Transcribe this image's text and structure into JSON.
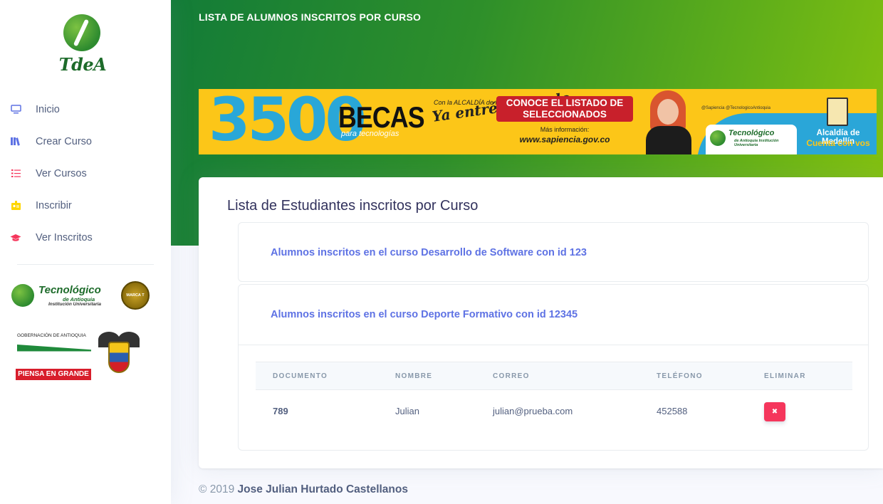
{
  "sidebar": {
    "brand": "TdeA",
    "items": [
      {
        "label": "Inicio",
        "icon": "tv-icon",
        "color": "#5e72e4"
      },
      {
        "label": "Crear Curso",
        "icon": "books-icon",
        "color": "#5e72e4"
      },
      {
        "label": "Ver Cursos",
        "icon": "list-icon",
        "color": "#f5365c"
      },
      {
        "label": "Inscribir",
        "icon": "badge-icon",
        "color": "#ffd600"
      },
      {
        "label": "Ver Inscritos",
        "icon": "graduation-cap-icon",
        "color": "#f5365c"
      }
    ],
    "tda_logo": {
      "title": "Tecnológico",
      "sub1": "de Antioquia",
      "sub2": "Institución Universitaria",
      "seal": "MARCA T"
    },
    "gob_logo": {
      "title": "GOBERNACIÓN DE ANTIOQUIA",
      "slogan": "PIENSA EN GRANDE"
    }
  },
  "header": {
    "title": "LISTA DE ALUMNOS INSCRITOS POR CURSO"
  },
  "banner": {
    "number": "3500",
    "becas": "BECAS",
    "para": "para tecnologías",
    "ya_small": "Con la ALCALDÍA de MEDELLÍN",
    "ya_big": "Ya entré ganando",
    "cta": "CONOCE EL LISTADO DE SELECCIONADOS",
    "more_info": "Más información:",
    "url": "www.sapiencia.gov.co",
    "social": "@Sapiencia  @TecnologicoAntioquia",
    "tda_title": "Tecnológico",
    "tda_sub": "de Antioquia Institución Universitaria",
    "alcaldia": "Alcaldía de Medellín",
    "cuenta": "Cuenta con vos"
  },
  "card": {
    "title": "Lista de Estudiantes inscritos por Curso",
    "courses": [
      {
        "heading": "Alumnos inscritos en el curso Desarrollo de Software con id 123"
      },
      {
        "heading": "Alumnos inscritos en el curso Deporte Formativo con id 12345"
      }
    ],
    "table": {
      "columns": [
        "DOCUMENTO",
        "NOMBRE",
        "CORREO",
        "TELÉFONO",
        "ELIMINAR"
      ],
      "rows": [
        {
          "documento": "789",
          "nombre": "Julian",
          "correo": "julian@prueba.com",
          "telefono": "452588",
          "eliminar": "✖"
        }
      ]
    }
  },
  "footer": {
    "copyright": "© 2019",
    "author": "Jose Julian Hurtado Castellanos"
  },
  "colors": {
    "accent": "#5e72e4",
    "danger": "#f5365c",
    "header_gradient_start": "#137c38",
    "header_gradient_end": "#86c20f",
    "banner_yellow": "#fcc618"
  }
}
